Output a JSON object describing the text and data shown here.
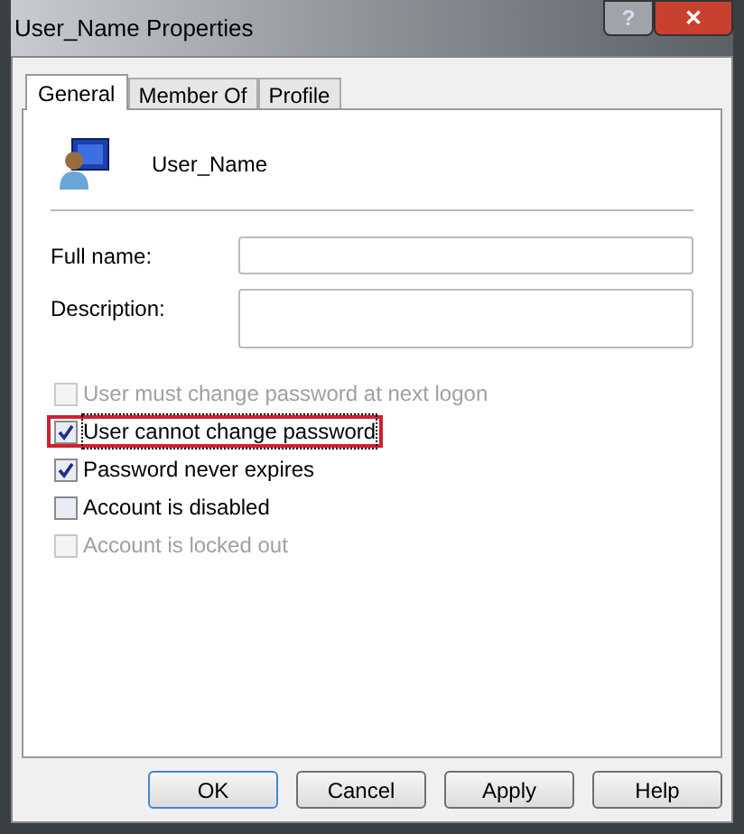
{
  "window": {
    "title": "User_Name Properties",
    "controls": [
      "?",
      "✕"
    ]
  },
  "tabs": [
    {
      "label": "General",
      "selected": true
    },
    {
      "label": "Member Of",
      "selected": false
    },
    {
      "label": "Profile",
      "selected": false
    }
  ],
  "user": {
    "name": "User_Name"
  },
  "fields": [
    {
      "label": "Full name:",
      "kind": "single"
    },
    {
      "label": "Description:",
      "kind": "multi"
    }
  ],
  "options": [
    {
      "label": "User must change password at next logon",
      "checked": false,
      "disabled": true,
      "highlighted": false
    },
    {
      "label": "User cannot change password",
      "checked": true,
      "disabled": false,
      "highlighted": true
    },
    {
      "label": "Password never expires",
      "checked": true,
      "disabled": false,
      "highlighted": false
    },
    {
      "label": "Account is disabled",
      "checked": false,
      "disabled": false,
      "highlighted": false
    },
    {
      "label": "Account is locked out",
      "checked": false,
      "disabled": true,
      "highlighted": false
    }
  ],
  "buttons": [
    {
      "label": "OK",
      "default": true
    },
    {
      "label": "Cancel",
      "default": false
    },
    {
      "label": "Apply",
      "default": false
    },
    {
      "label": "Help",
      "default": false
    }
  ]
}
